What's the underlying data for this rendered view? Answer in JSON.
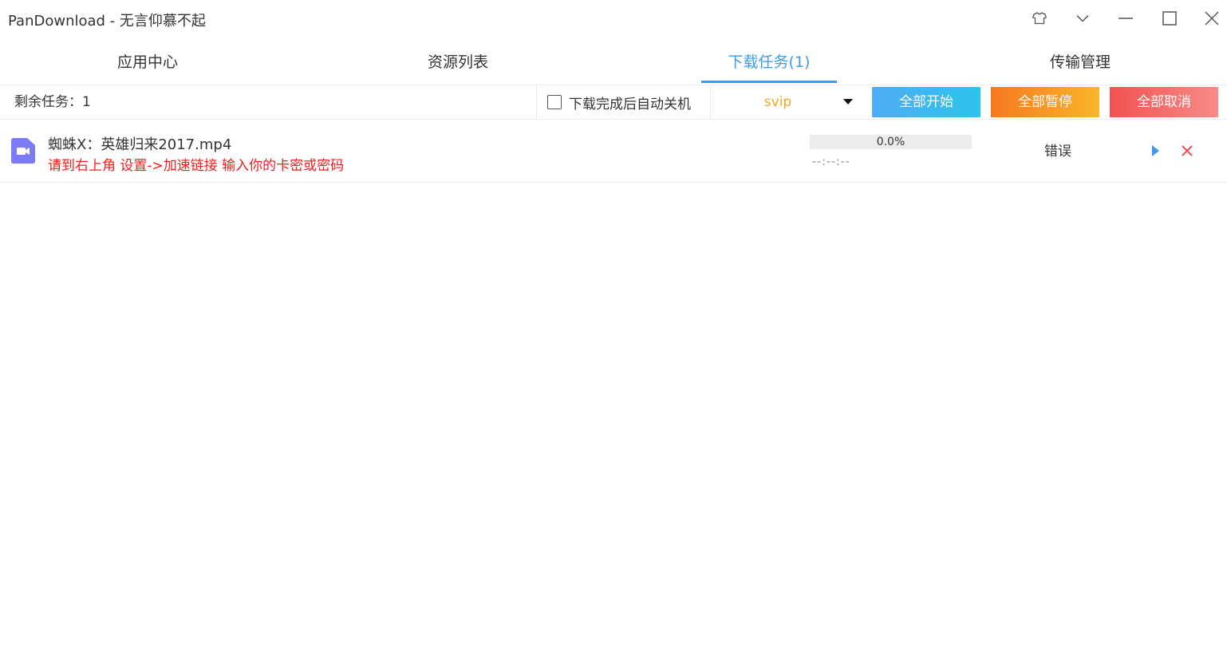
{
  "window": {
    "title": "PanDownload - 无言仰慕不起",
    "icons": [
      "skin-icon",
      "menu-chevron-icon",
      "minimize-icon",
      "maximize-icon",
      "close-icon"
    ]
  },
  "tabs": [
    {
      "label": "应用中心"
    },
    {
      "label": "资源列表"
    },
    {
      "label": "下载任务(1)"
    },
    {
      "label": "传输管理"
    }
  ],
  "toolbar": {
    "remaining": "剩余任务：1",
    "shutdown_label": "下载完成后自动关机",
    "mode_value": "svip",
    "start_all": "全部开始",
    "pause_all": "全部暂停",
    "cancel_all": "全部取消"
  },
  "tasks": [
    {
      "name": "蜘蛛X：英雄归来2017.mp4",
      "message": "请到右上角 设置->加速链接 输入你的卡密或密码",
      "progress_text": "0.0%",
      "progress_percent": 0,
      "time": "--:--:--",
      "status": "错误"
    }
  ],
  "colors": {
    "accent": "#3d9be9",
    "error_text": "#f01e1e",
    "mode_text": "#f5a623",
    "file_icon": "#7b7cf4"
  }
}
